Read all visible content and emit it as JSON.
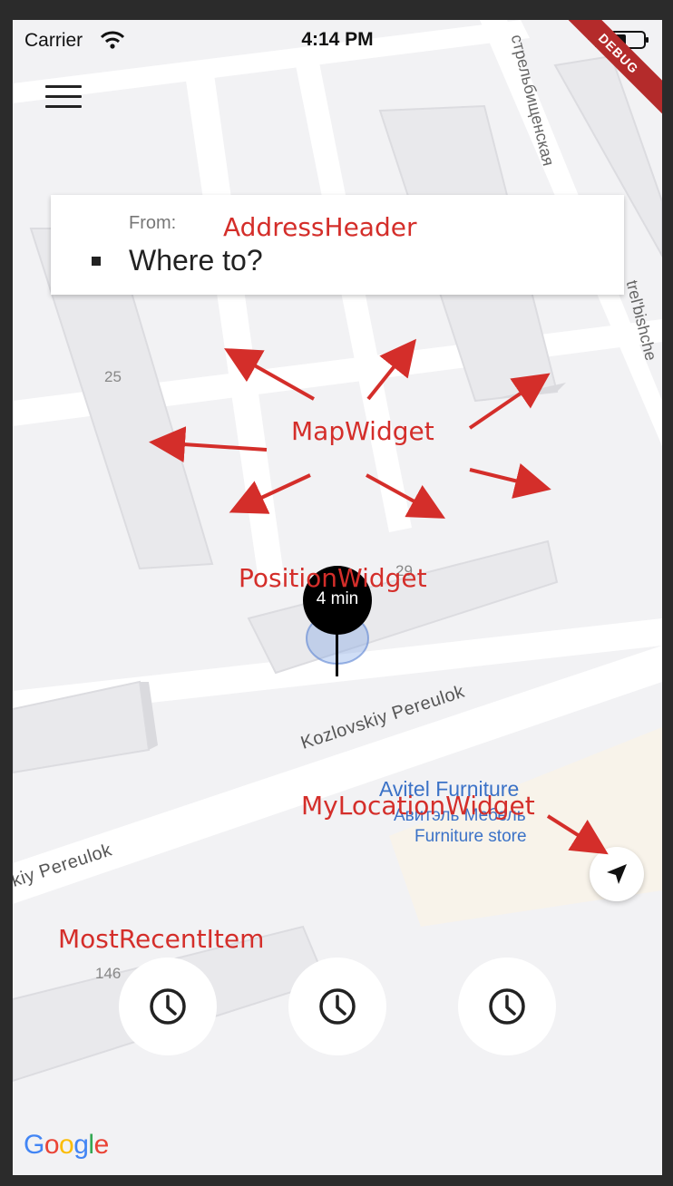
{
  "status_bar": {
    "carrier": "Carrier",
    "time": "4:14 PM"
  },
  "debug_banner": "DEBUG",
  "address_header": {
    "from_label": "From:",
    "destination_placeholder": "Where to?"
  },
  "map": {
    "street_labels": [
      "Kozlovskiy Pereulok",
      "kiy Pereulok",
      "стрельбищенская",
      "trel'bishche"
    ],
    "building_numbers": [
      "25",
      "29",
      "146"
    ],
    "poi": {
      "name": "Avitel Furniture",
      "local_name": "Авитэль Мебель",
      "category": "Furniture store"
    },
    "attribution": "Google"
  },
  "position_widget": {
    "eta": "4 min"
  },
  "recent_items": [
    {
      "icon": "clock-icon"
    },
    {
      "icon": "clock-icon"
    },
    {
      "icon": "clock-icon"
    }
  ],
  "my_location": {
    "icon": "navigation-arrow-icon"
  },
  "annotations": {
    "address_header": "AddressHeader",
    "map_widget": "MapWidget",
    "position_widget": "PositionWidget",
    "my_location_widget": "MyLocationWidget",
    "most_recent_item": "MostRecentItem"
  },
  "colors": {
    "annotation": "#d42e2a",
    "poi": "#3b72c7",
    "road": "#ffffff",
    "building": "#e9e9ec",
    "poi_area": "#f8f3ea"
  }
}
